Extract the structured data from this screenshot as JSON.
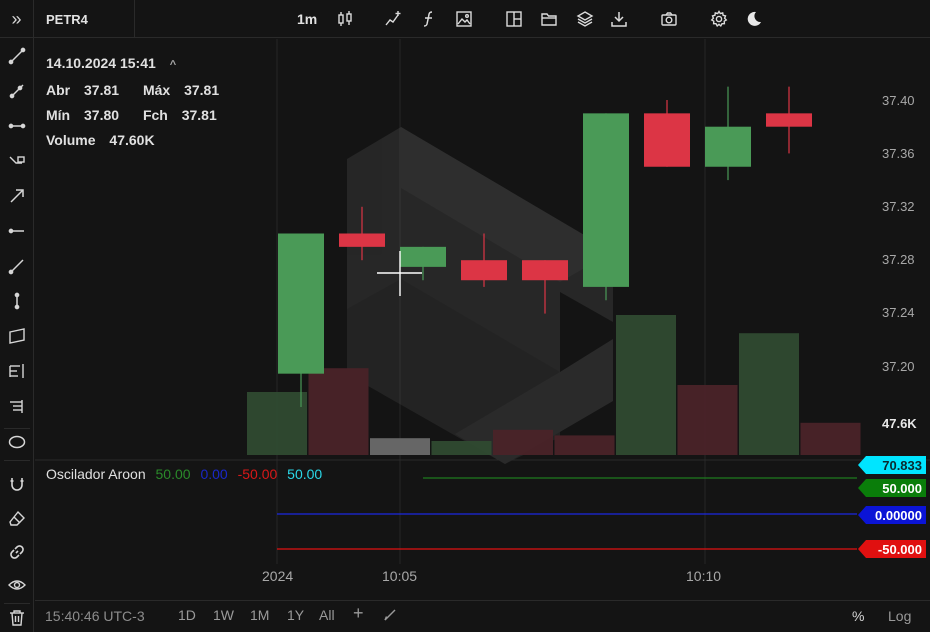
{
  "toolbar": {
    "symbol": "PETR4",
    "interval": "1m",
    "icons": [
      "chevrons-right-icon",
      "candles-icon",
      "indicator-line-icon",
      "function-icon",
      "image-icon",
      "layout-icon",
      "folder-icon",
      "layers-icon",
      "download-icon",
      "camera-icon",
      "gear-icon",
      "moon-icon"
    ]
  },
  "left_tools": [
    "line-tool-icon",
    "ray-tool-icon",
    "horizontal-range-icon",
    "channel-icon",
    "arrow-icon",
    "horizontal-line-icon",
    "pen-icon",
    "vertical-line-icon",
    "parallelogram-icon",
    "fib-icon",
    "text-tool-icon",
    "ellipse-icon",
    "magnet-icon",
    "eraser-icon",
    "link-icon",
    "eye-icon",
    "trash-icon"
  ],
  "legend": {
    "datetime": "14.10.2024 15:41",
    "open_label": "Abr",
    "open": "37.81",
    "high_label": "Máx",
    "high": "37.81",
    "low_label": "Mín",
    "low": "37.80",
    "close_label": "Fch",
    "close": "37.81",
    "volume_label": "Volume",
    "volume": "47.60K"
  },
  "indicator": {
    "name": "Oscilador Aroon",
    "v1": "50.00",
    "v2": "0.00",
    "v3": "-50.00",
    "v4": "50.00",
    "badge_cyan": "70.833",
    "badge_green": "50.000",
    "badge_blue": "0.00000",
    "badge_red": "-50.000"
  },
  "price_axis": [
    "37.40",
    "37.36",
    "37.32",
    "37.28",
    "37.24",
    "37.20"
  ],
  "volume_axis_label": "47.6K",
  "time_axis": [
    "2024",
    "10:05",
    "10:10"
  ],
  "bottom": {
    "clock": "15:40:46 UTC-3",
    "ranges": [
      "1D",
      "1W",
      "1M",
      "1Y",
      "All"
    ],
    "percent": "%",
    "log": "Log"
  },
  "colors": {
    "up": "#4a9a57",
    "down": "#dc3545",
    "cyan": "#00e5ff",
    "green_badge": "#0a7d0a",
    "blue_badge": "#0b14d6",
    "red_badge": "#e01010"
  },
  "chart_data": {
    "type": "candlestick",
    "y_range": [
      37.17,
      37.43
    ],
    "candles": [
      {
        "open": 37.195,
        "high": 37.3,
        "low": 37.17,
        "close": 37.3
      },
      {
        "open": 37.3,
        "high": 37.32,
        "low": 37.28,
        "close": 37.29
      },
      {
        "open": 37.275,
        "high": 37.29,
        "low": 37.265,
        "close": 37.29
      },
      {
        "open": 37.28,
        "high": 37.3,
        "low": 37.26,
        "close": 37.265
      },
      {
        "open": 37.28,
        "high": 37.28,
        "low": 37.24,
        "close": 37.265
      },
      {
        "open": 37.26,
        "high": 37.39,
        "low": 37.25,
        "close": 37.39
      },
      {
        "open": 37.39,
        "high": 37.4,
        "low": 37.35,
        "close": 37.35
      },
      {
        "open": 37.35,
        "high": 37.41,
        "low": 37.34,
        "close": 37.38
      },
      {
        "open": 37.39,
        "high": 37.41,
        "low": 37.36,
        "close": 37.38
      }
    ],
    "volume_bars": [
      {
        "level": 0.45,
        "kind": "up"
      },
      {
        "level": 0.62,
        "kind": "down"
      },
      {
        "level": 0.12,
        "kind": "neutral"
      },
      {
        "level": 0.1,
        "kind": "up"
      },
      {
        "level": 0.18,
        "kind": "down"
      },
      {
        "level": 0.14,
        "kind": "down"
      },
      {
        "level": 1.0,
        "kind": "up"
      },
      {
        "level": 0.5,
        "kind": "down"
      },
      {
        "level": 0.87,
        "kind": "up"
      },
      {
        "level": 0.23,
        "kind": "down"
      }
    ]
  }
}
